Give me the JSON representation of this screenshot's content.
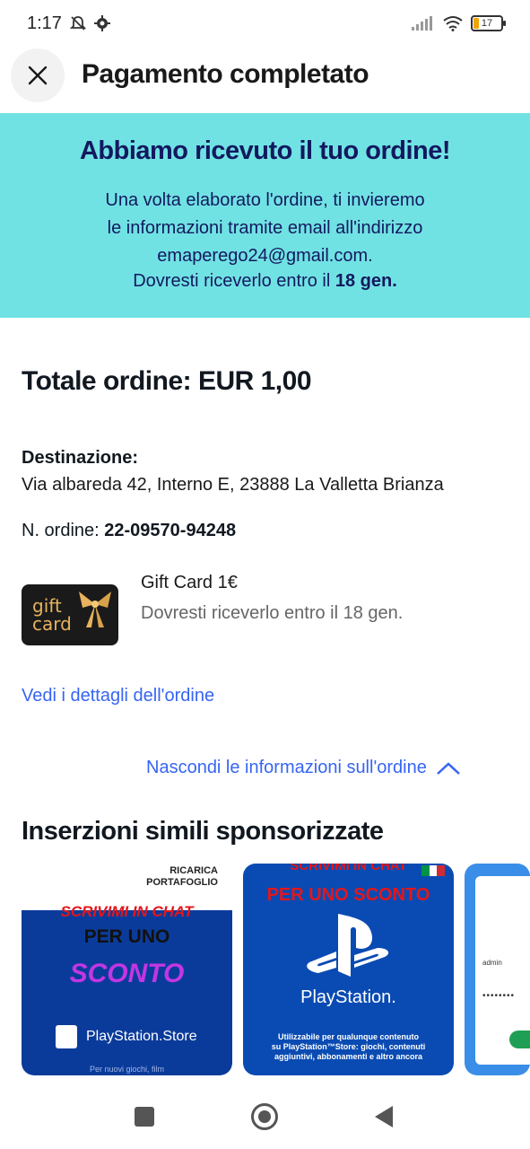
{
  "status_bar": {
    "time": "1:17",
    "battery": "17",
    "icons": [
      "mute-icon",
      "gear-icon",
      "signal-icon",
      "wifi-icon",
      "battery-icon"
    ]
  },
  "header": {
    "title": "Pagamento completato",
    "close_icon": "close-icon"
  },
  "banner": {
    "title": "Abbiamo ricevuto il tuo ordine!",
    "line1": "Una volta elaborato l'ordine, ti invieremo",
    "line2": "le informazioni tramite email all'indirizzo",
    "line3": "emaperego24@gmail.com.",
    "date_prefix": "Dovresti riceverlo entro il ",
    "date_value": "18 gen.",
    "background": "#71e2e3",
    "text_color": "#12195f"
  },
  "order": {
    "total": "Totale ordine: EUR 1,00",
    "destination_label": "Destinazione:",
    "destination_value": "Via albareda 42, Interno E, 23888 La Valletta Brianza",
    "number_label": "N. ordine: ",
    "number_value": "22-09570-94248",
    "item": {
      "thumb_line1": "gift",
      "thumb_line2": "card",
      "name": "Gift Card 1€",
      "eta": "Dovresti riceverlo entro il 18 gen."
    },
    "details_link": "Vedi i dettagli dell'ordine",
    "hide_link": "Nascondi le informazioni sull'ordine",
    "link_color": "#3665f3"
  },
  "sponsored": {
    "title": "Inserzioni simili sponsorizzate",
    "cards": [
      {
        "top_label_1": "RICARICA",
        "top_label_2": "PORTAFOGLIO",
        "line_red": "SCRIVIMI IN CHAT",
        "line_black": "PER UNO",
        "line_purple": "SCONTO",
        "store": "PlayStation.Store",
        "bottom": "Per nuovi giochi, film"
      },
      {
        "top_label": "SCRIVIMI IN CHAT",
        "line_red": "PER UNO SCONTO",
        "brand": "PlayStation.",
        "small_1": "Utilizzabile per qualunque contenuto",
        "small_2": "su PlayStation™Store: giochi, contenuti",
        "small_3": "aggiuntivi, abbonamenti e altro ancora"
      },
      {
        "field_user": "admin",
        "field_pass": "••••••••"
      }
    ]
  },
  "nav_bar": {
    "icons": [
      "recent-apps-icon",
      "home-icon",
      "back-icon"
    ]
  }
}
